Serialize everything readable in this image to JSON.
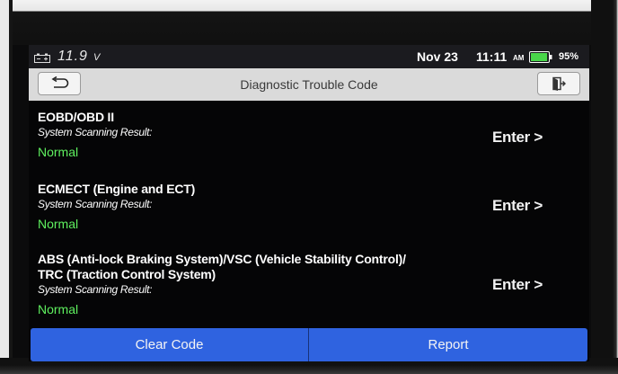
{
  "status_bar": {
    "voltage": "11.9",
    "voltage_unit": "V",
    "date": "Nov 23",
    "time": "11:11",
    "ampm": "AM",
    "battery_percent": "95%",
    "battery_level": 0.95,
    "battery_color": "#49d64a",
    "left_icon": "car-battery-icon"
  },
  "title_bar": {
    "title": "Diagnostic Trouble Code",
    "back_icon": "back-arrow-icon",
    "exit_icon": "exit-icon"
  },
  "systems": [
    {
      "name": "EOBD/OBD II",
      "subtitle": "System Scanning Result:",
      "result": "Normal",
      "action": "Enter >"
    },
    {
      "name": "ECMECT (Engine and ECT)",
      "subtitle": "System Scanning Result:",
      "result": "Normal",
      "action": "Enter >"
    },
    {
      "name_line1": "ABS (Anti-lock Braking System)/VSC (Vehicle Stability Control)/",
      "name_line2": "TRC (Traction Control System)",
      "subtitle": "System Scanning Result:",
      "result": "Normal",
      "action": "Enter >"
    }
  ],
  "bottom_bar": {
    "clear_label": "Clear Code",
    "report_label": "Report"
  },
  "colors": {
    "accent_blue": "#2f63e0",
    "normal_green": "#5ff05f",
    "title_bar_bg": "#dadada"
  }
}
